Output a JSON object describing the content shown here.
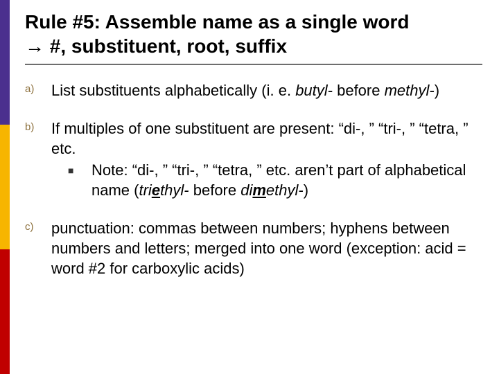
{
  "title_line1": "Rule #5: Assemble name as a single word",
  "title_line2_prefix": "→",
  "title_line2": " #, substituent, root, suffix",
  "items": {
    "a_marker": "a)",
    "a_pre": "List substituents alphabetically (i. e. ",
    "a_ital1": "butyl-",
    "a_mid": " before ",
    "a_ital2": "methyl-",
    "a_post": ")",
    "b_marker": "b)",
    "b_text": "If multiples of one substituent are present: “di-, ” “tri-, ” “tetra, ” etc.",
    "b_sub_pre": "Note: “di-, ” “tri-, ” “tetra, ” etc. aren’t part of alphabetical name (",
    "b_sub_i1a": "tri",
    "b_sub_i1b": "e",
    "b_sub_i1c": "thyl-",
    "b_sub_mid": " before ",
    "b_sub_i2a": "di",
    "b_sub_i2b": "m",
    "b_sub_i2c": "ethyl-",
    "b_sub_post": ")",
    "c_marker": "c)",
    "c_text": "punctuation: commas between numbers; hyphens between numbers and letters; merged into one word (exception: acid = word #2 for carboxylic acids)"
  }
}
